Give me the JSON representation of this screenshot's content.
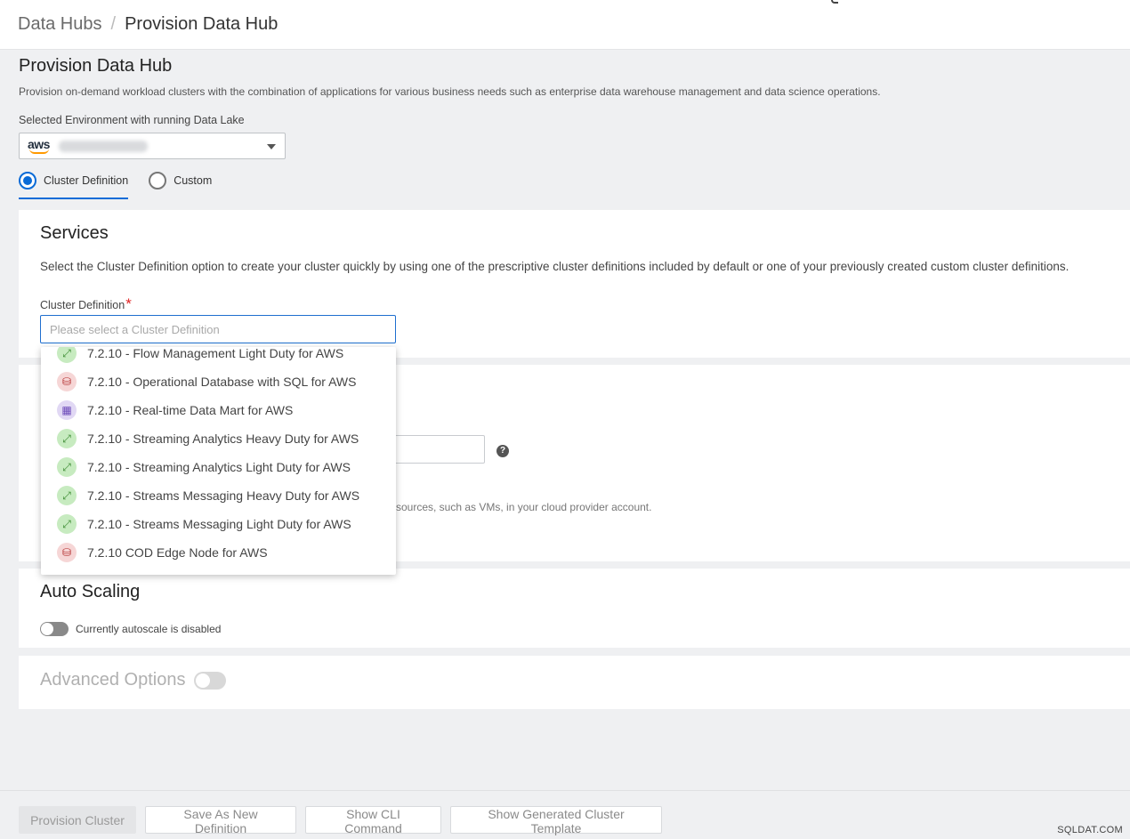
{
  "breadcrumb": {
    "parent": "Data Hubs",
    "separator": "/",
    "current": "Provision Data Hub"
  },
  "page": {
    "title": "Provision Data Hub",
    "description": "Provision on-demand workload clusters with the combination of applications for various business needs such as enterprise data warehouse management and data science operations."
  },
  "environment": {
    "label": "Selected Environment with running Data Lake",
    "provider_logo": "aws"
  },
  "mode": {
    "options": [
      {
        "label": "Cluster Definition",
        "selected": true
      },
      {
        "label": "Custom",
        "selected": false
      }
    ]
  },
  "services": {
    "title": "Services",
    "description": "Select the Cluster Definition option to create your cluster quickly by using one of the prescriptive cluster definitions included by default or one of your previously created custom cluster definitions.",
    "field_label": "Cluster Definition",
    "required_mark": "*",
    "placeholder": "Please select a Cluster Definition"
  },
  "general": {
    "help_icon": "?",
    "hint_text": "sources, such as VMs, in your cloud provider account."
  },
  "cluster_definitions": [
    {
      "label": "7.2.10 - Flow Management Light Duty for AWS",
      "icon": "scale-arrow-icon",
      "color": "green"
    },
    {
      "label": "7.2.10 - Operational Database with SQL for AWS",
      "icon": "database-icon",
      "color": "red"
    },
    {
      "label": "7.2.10 - Real-time Data Mart for AWS",
      "icon": "data-mart-icon",
      "color": "purple"
    },
    {
      "label": "7.2.10 - Streaming Analytics Heavy Duty for AWS",
      "icon": "scale-arrow-icon",
      "color": "green"
    },
    {
      "label": "7.2.10 - Streaming Analytics Light Duty for AWS",
      "icon": "scale-arrow-icon",
      "color": "green"
    },
    {
      "label": "7.2.10 - Streams Messaging Heavy Duty for AWS",
      "icon": "scale-arrow-icon",
      "color": "green"
    },
    {
      "label": "7.2.10 - Streams Messaging Light Duty for AWS",
      "icon": "scale-arrow-icon",
      "color": "green"
    },
    {
      "label": "7.2.10 COD Edge Node for AWS",
      "icon": "database-icon",
      "color": "red"
    }
  ],
  "autoscaling": {
    "title": "Auto Scaling",
    "status": "Currently autoscale is disabled",
    "enabled": false
  },
  "advanced": {
    "title": "Advanced Options",
    "enabled": false
  },
  "footer": {
    "buttons": [
      "Provision Cluster",
      "Save As New Definition",
      "Show CLI Command",
      "Show Generated Cluster Template"
    ],
    "watermark": "SQLDAT.COM"
  },
  "colors": {
    "accent": "#0a6bd7",
    "required": "#e02424",
    "icon_green": "#3b8a31",
    "icon_red": "#b22a2a",
    "icon_purple": "#6a47b8"
  }
}
